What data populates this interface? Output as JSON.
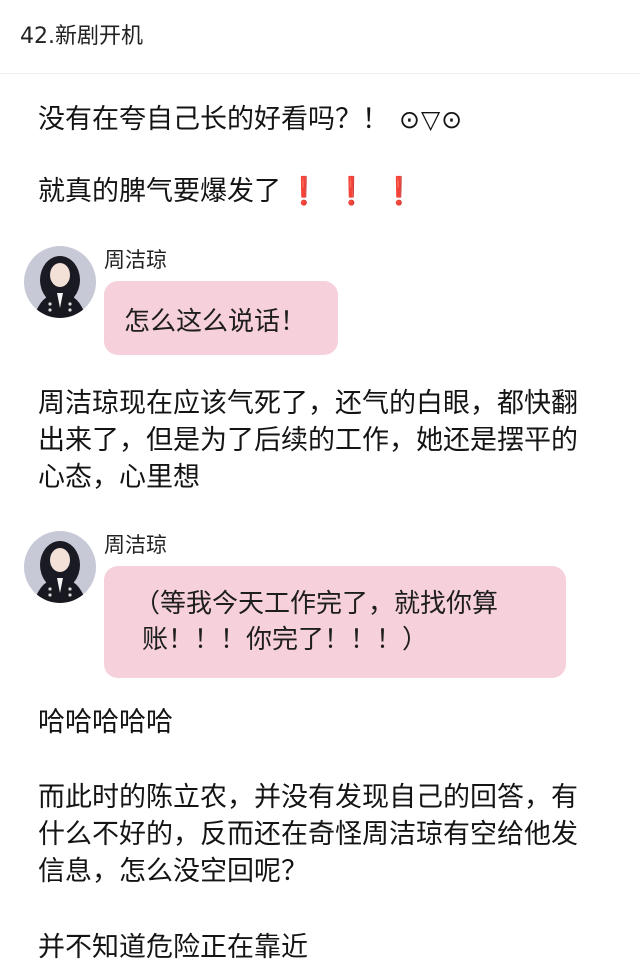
{
  "header": {
    "title": "42.新剧开机"
  },
  "paragraphs": {
    "p1": "没有在夸自己长的好看吗？！",
    "p1_emoji": "⊙▽⊙",
    "p2": "就真的脾气要爆发了",
    "p2_emoji": "❗❗❗",
    "p3_line1": "周洁琼现在应该气死了，还气的白眼，都快翻",
    "p3_line2": "出来了，但是为了后续的工作，她还是摆平的",
    "p3_line3": "心态，心里想",
    "p4": "哈哈哈哈哈",
    "p5_line1": "而此时的陈立农，并没有发现自己的回答，有",
    "p5_line2": "什么不好的，反而还在奇怪周洁琼有空给他发",
    "p5_line3": "信息，怎么没空回呢？",
    "p6": "并不知道危险正在靠近"
  },
  "chat1": {
    "name": "周洁琼",
    "message": "怎么这么说话！"
  },
  "chat2": {
    "name": "周洁琼",
    "message_line1": "（等我今天工作完了，就找你算",
    "message_line2": "账！！！你完了！！！）"
  },
  "colors": {
    "bubble": "#f6d0db",
    "text": "#141414",
    "exclaim": "#e02020"
  }
}
